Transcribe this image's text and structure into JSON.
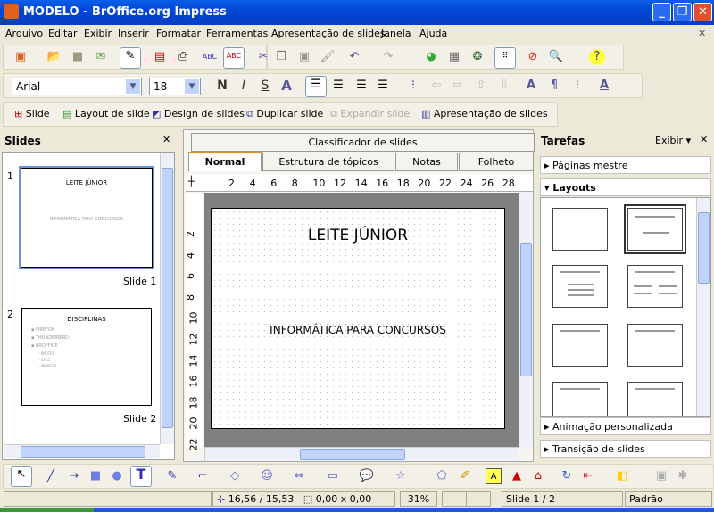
{
  "window": {
    "title": "MODELO - BrOffice.org Impress",
    "minimize": "_",
    "restore": "❐",
    "close": "✕"
  },
  "menu": [
    "Arquivo",
    "Editar",
    "Exibir",
    "Inserir",
    "Formatar",
    "Ferramentas",
    "Apresentação de slides",
    "Janela",
    "Ajuda"
  ],
  "menu_close": "✕",
  "formatting": {
    "font": "Arial",
    "size": "18",
    "bold": "N",
    "italic": "I",
    "shadow": "S",
    "outline": "A",
    "font_color": "A"
  },
  "presentation_toolbar": {
    "slide": "Slide",
    "layout": "Layout de slide",
    "design": "Design de slides",
    "duplicate": "Duplicar slide",
    "expand": "Expandir slide",
    "show": "Apresentação de slides"
  },
  "slides_panel": {
    "title": "Slides",
    "close": "✕",
    "slides": [
      {
        "number": "1",
        "label": "Slide 1",
        "title": "LEITE JÚNIOR",
        "subtitle": "INFORMÁTICA PARA CONCURSOS"
      },
      {
        "number": "2",
        "label": "Slide 2",
        "title": "DISCIPLINAS",
        "bullets": [
          "FIREFOX",
          "THUNDERBIRD",
          "BROFFICE"
        ],
        "sub_bullets": [
          "WRITER",
          "CALC",
          "IMPRESS"
        ]
      }
    ]
  },
  "view_tabs": {
    "top": "Classificador de slides",
    "tabs": [
      "Normal",
      "Estrutura de tópicos",
      "Notas",
      "Folheto"
    ],
    "active": "Normal"
  },
  "ruler": {
    "h": [
      "2",
      "4",
      "6",
      "8",
      "10",
      "12",
      "14",
      "16",
      "18",
      "20",
      "22",
      "24",
      "26",
      "28"
    ],
    "v": [
      "2",
      "4",
      "6",
      "8",
      "10",
      "12",
      "14",
      "16",
      "18",
      "20",
      "22"
    ]
  },
  "slide": {
    "title": "LEITE JÚNIOR",
    "subtitle": "INFORMÁTICA PARA CONCURSOS"
  },
  "tasks": {
    "title": "Tarefas",
    "view": "Exibir",
    "close": "✕",
    "sections": [
      "Páginas mestre",
      "Layouts",
      "Animação personalizada",
      "Transição de slides"
    ]
  },
  "status": {
    "position": "16,56 / 15,53",
    "size": "0,00 x 0,00",
    "zoom": "31%",
    "slide": "Slide 1 / 2",
    "style": "Padrão"
  }
}
